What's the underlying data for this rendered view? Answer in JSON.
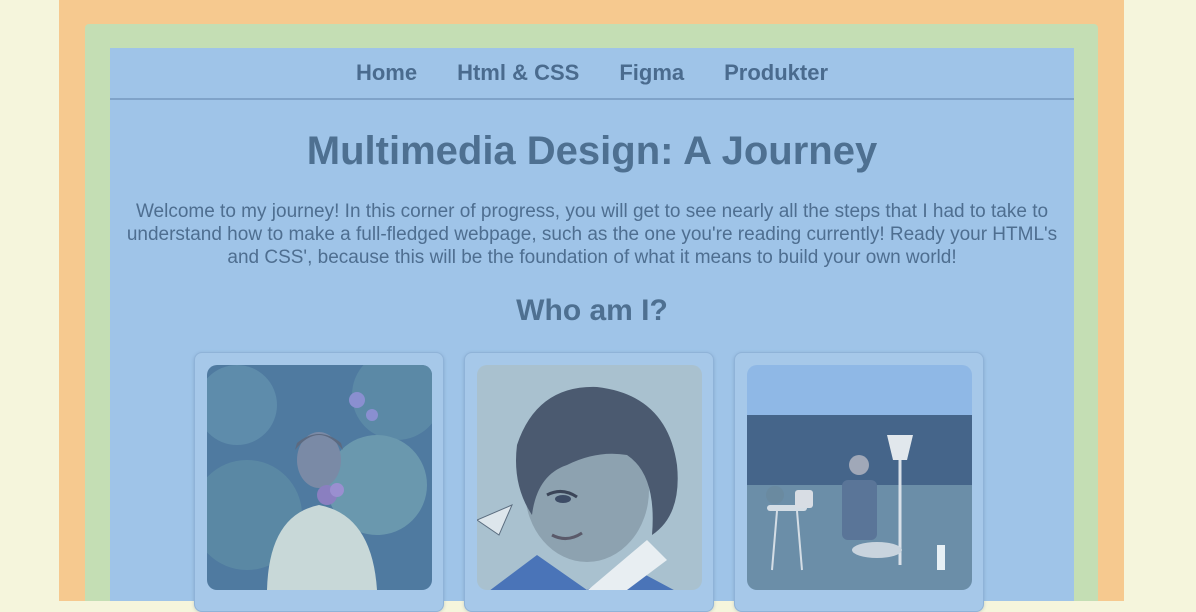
{
  "nav": {
    "items": [
      "Home",
      "Html & CSS",
      "Figma",
      "Produkter"
    ]
  },
  "main": {
    "title": "Multimedia Design: A Journey",
    "intro": "Welcome to my journey! In this corner of progress, you will get to see nearly all the steps that I had to take to understand how to make a full-fledged webpage, such as the one you're reading currently! Ready your HTML's and CSS', because this will be the foundation of what it means to build your own world!",
    "subtitle": "Who am I?"
  },
  "colors": {
    "outer": "#f5f5dc",
    "orange_frame": "#f6c98f",
    "green_frame": "#c4deb4",
    "panel": "#9fc4e8",
    "text": "#4a6b8e"
  },
  "cards": [
    {
      "image": "photo-person-with-flowers"
    },
    {
      "image": "illustration-portrait"
    },
    {
      "image": "photo-person-in-garden-chair"
    }
  ]
}
